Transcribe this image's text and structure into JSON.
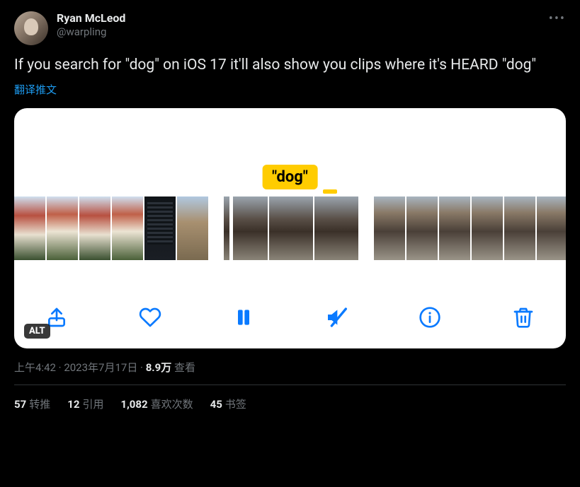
{
  "author": {
    "display_name": "Ryan McLeod",
    "handle": "@warpling"
  },
  "tweet_text": "If you search for \"dog\" on iOS 17 it'll also show you clips where it's HEARD \"dog\"",
  "translate_label": "翻译推文",
  "media": {
    "tag_text": "\"dog\"",
    "alt_badge": "ALT",
    "toolbar": {
      "share": "share-icon",
      "like": "heart-icon",
      "pause": "pause-icon",
      "mute": "speaker-muted-icon",
      "info": "info-icon",
      "delete": "trash-icon"
    }
  },
  "meta": {
    "time": "上午4:42",
    "sep": " · ",
    "date": "2023年7月17日",
    "views_value": "8.9万",
    "views_label": " 查看"
  },
  "stats": {
    "retweets": {
      "count": "57",
      "label": "转推"
    },
    "quotes": {
      "count": "12",
      "label": "引用"
    },
    "likes": {
      "count": "1,082",
      "label": "喜欢次数"
    },
    "bookmarks": {
      "count": "45",
      "label": "书签"
    }
  }
}
